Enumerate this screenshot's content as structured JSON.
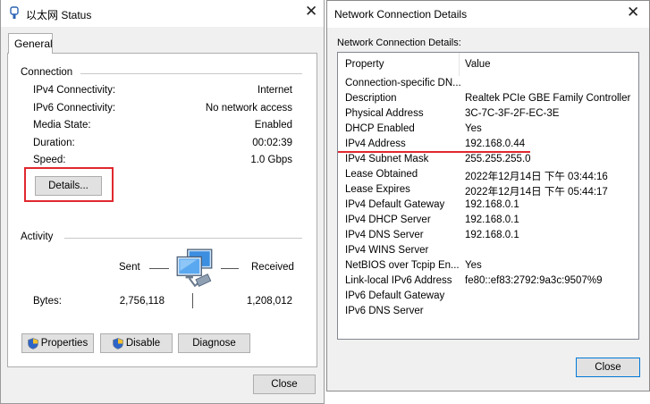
{
  "status_window": {
    "title": "以太网 Status",
    "tab": "General",
    "connection": {
      "heading": "Connection",
      "rows": [
        {
          "label": "IPv4 Connectivity:",
          "value": "Internet"
        },
        {
          "label": "IPv6 Connectivity:",
          "value": "No network access"
        },
        {
          "label": "Media State:",
          "value": "Enabled"
        },
        {
          "label": "Duration:",
          "value": "00:02:39"
        },
        {
          "label": "Speed:",
          "value": "1.0 Gbps"
        }
      ],
      "details_button": "Details..."
    },
    "activity": {
      "heading": "Activity",
      "sent_label": "Sent",
      "received_label": "Received",
      "bytes_label": "Bytes:",
      "bytes_sent": "2,756,118",
      "bytes_received": "1,208,012"
    },
    "buttons": {
      "properties": "Properties",
      "disable": "Disable",
      "diagnose": "Diagnose",
      "close": "Close"
    },
    "close_glyph": "✕",
    "highlight_color": "#e0282e"
  },
  "details_window": {
    "title": "Network Connection Details",
    "subtitle": "Network Connection Details:",
    "columns": {
      "property": "Property",
      "value": "Value"
    },
    "rows": [
      {
        "property": "Connection-specific DN...",
        "value": ""
      },
      {
        "property": "Description",
        "value": "Realtek PCIe GBE Family Controller"
      },
      {
        "property": "Physical Address",
        "value": "3C-7C-3F-2F-EC-3E"
      },
      {
        "property": "DHCP Enabled",
        "value": "Yes"
      },
      {
        "property": "IPv4 Address",
        "value": "192.168.0.44"
      },
      {
        "property": "IPv4 Subnet Mask",
        "value": "255.255.255.0"
      },
      {
        "property": "Lease Obtained",
        "value": "2022年12月14日 下午 03:44:16"
      },
      {
        "property": "Lease Expires",
        "value": "2022年12月14日 下午 05:44:17"
      },
      {
        "property": "IPv4 Default Gateway",
        "value": "192.168.0.1"
      },
      {
        "property": "IPv4 DHCP Server",
        "value": "192.168.0.1"
      },
      {
        "property": "IPv4 DNS Server",
        "value": "192.168.0.1"
      },
      {
        "property": "IPv4 WINS Server",
        "value": ""
      },
      {
        "property": "NetBIOS over Tcpip En...",
        "value": "Yes"
      },
      {
        "property": "Link-local IPv6 Address",
        "value": "fe80::ef83:2792:9a3c:9507%9"
      },
      {
        "property": "IPv6 Default Gateway",
        "value": ""
      },
      {
        "property": "IPv6 DNS Server",
        "value": ""
      }
    ],
    "close_button": "Close",
    "close_glyph": "✕"
  }
}
